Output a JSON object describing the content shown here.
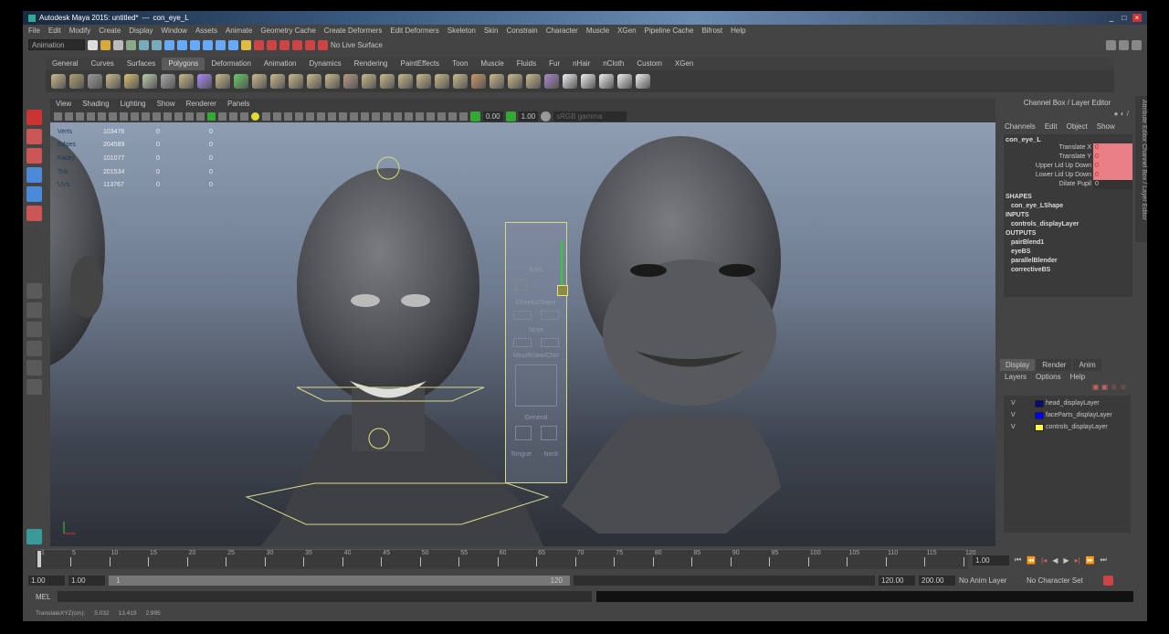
{
  "window": {
    "title": "Autodesk Maya 2015: untitled*",
    "separator": "---",
    "object": "con_eye_L",
    "controls": [
      "_",
      "□",
      "×"
    ]
  },
  "menubar": [
    "File",
    "Edit",
    "Modify",
    "Create",
    "Display",
    "Window",
    "Assets",
    "Animate",
    "Geometry Cache",
    "Create Deformers",
    "Edit Deformers",
    "Skeleton",
    "Skin",
    "Constrain",
    "Character",
    "Muscle",
    "XGen",
    "Pipeline Cache",
    "Bifrost",
    "Help"
  ],
  "statusline": {
    "menuset": "Animation",
    "live_surface": "No Live Surface"
  },
  "shelf_tabs": [
    "General",
    "Curves",
    "Surfaces",
    "Polygons",
    "Deformation",
    "Animation",
    "Dynamics",
    "Rendering",
    "PaintEffects",
    "Toon",
    "Muscle",
    "Fluids",
    "Fur",
    "nHair",
    "nCloth",
    "Custom",
    "XGen"
  ],
  "shelf_active": "Polygons",
  "panel": {
    "menu": [
      "View",
      "Shading",
      "Lighting",
      "Show",
      "Renderer",
      "Panels"
    ],
    "exposure": "0.00",
    "gamma": "1.00",
    "color_space": "sRGB gamma"
  },
  "hud": {
    "rows": [
      {
        "label": "Verts",
        "v": "103476",
        "a": "0",
        "b": "0"
      },
      {
        "label": "Edges",
        "v": "204589",
        "a": "0",
        "b": "0"
      },
      {
        "label": "Faces",
        "v": "101077",
        "a": "0",
        "b": "0"
      },
      {
        "label": "Tris",
        "v": "201534",
        "a": "0",
        "b": "0"
      },
      {
        "label": "UVs",
        "v": "113767",
        "a": "0",
        "b": "0"
      }
    ]
  },
  "picker": {
    "labels": [
      "Eyes",
      "Cheeks/Sneer",
      "Nose",
      "Mouth/Jaw/Chin",
      "General",
      "Tongue",
      "Neck"
    ]
  },
  "channel_box": {
    "title": "Channel Box / Layer Editor",
    "menu": [
      "Channels",
      "Edit",
      "Object",
      "Show"
    ],
    "node": "con_eye_L",
    "attributes": [
      {
        "name": "Translate X",
        "value": "0"
      },
      {
        "name": "Translate Y",
        "value": "0"
      },
      {
        "name": "Upper Lid Up Down",
        "value": "0"
      },
      {
        "name": "Lower Lid Up Down",
        "value": "0"
      },
      {
        "name": "Dilate Pupil",
        "value": "0"
      }
    ],
    "shapes_label": "SHAPES",
    "shapes": [
      "con_eye_LShape"
    ],
    "inputs_label": "INPUTS",
    "inputs": [
      "controls_displayLayer"
    ],
    "outputs_label": "OUTPUTS",
    "outputs": [
      "pairBlend1",
      "eyeBS",
      "parallelBlender",
      "correctiveBS"
    ]
  },
  "right_strip": "Attribute Editor  Channel Box / Layer Editor",
  "layer_editor": {
    "tabs": [
      "Display",
      "Render",
      "Anim"
    ],
    "menu": [
      "Layers",
      "Options",
      "Help"
    ],
    "layers": [
      {
        "v": "V",
        "name": "head_displayLayer",
        "color": "#0a0a80"
      },
      {
        "v": "V",
        "name": "faceParts_displayLayer",
        "color": "#0000ff"
      },
      {
        "v": "V",
        "name": "controls_displayLayer",
        "color": "#ffff40"
      }
    ]
  },
  "timeline": {
    "ticks": [
      "1",
      "5",
      "10",
      "15",
      "20",
      "25",
      "30",
      "35",
      "40",
      "45",
      "50",
      "55",
      "60",
      "65",
      "70",
      "75",
      "80",
      "85",
      "90",
      "95",
      "100",
      "105",
      "110",
      "115",
      "120"
    ],
    "current": "1.00"
  },
  "range": {
    "start": "1.00",
    "anim_start": "1.00",
    "slider_start": "1",
    "slider_end": "120",
    "end": "120.00",
    "anim_end": "200.00",
    "anim_layer": "No Anim Layer",
    "char_set": "No Character Set"
  },
  "mel": {
    "label": "MEL"
  },
  "helpline": {
    "label": "TranslateXYZ(cm):",
    "x": "5.032",
    "y": "13.419",
    "z": "2.995"
  }
}
